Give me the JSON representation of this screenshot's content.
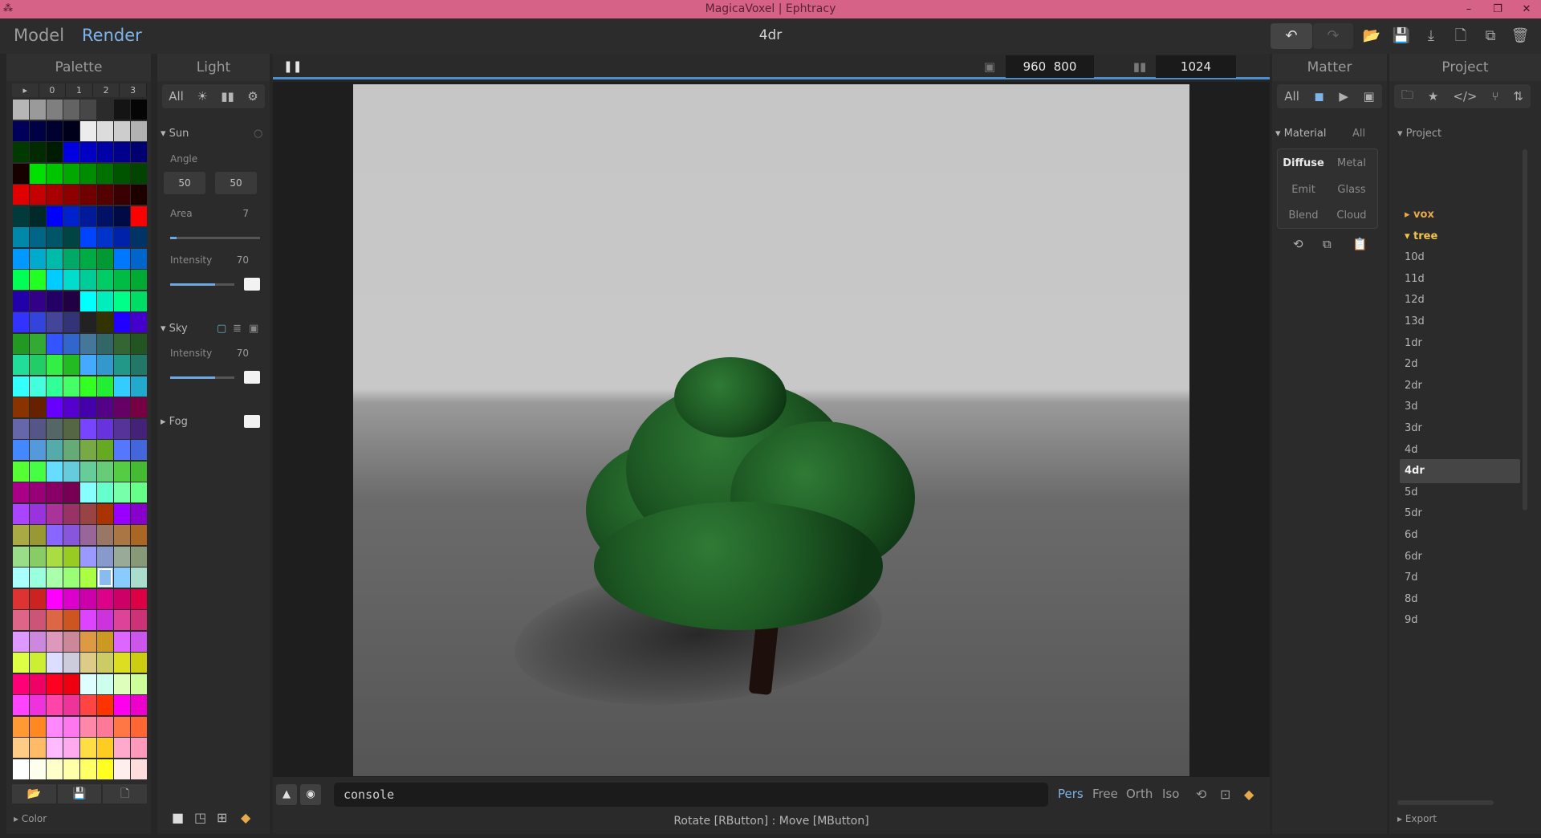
{
  "window": {
    "title": "MagicaVoxel | Ephtracy",
    "minimize": "–",
    "restore": "❐",
    "close": "✕"
  },
  "menu": {
    "model": "Model",
    "render": "Render",
    "doc_title": "4dr"
  },
  "palette": {
    "title": "Palette",
    "tabs": [
      "▸",
      "0",
      "1",
      "2",
      "3"
    ],
    "footer_label": "Color",
    "colors": [
      [
        "#b6b6b6",
        "#9a9a9a",
        "#7f7f7f",
        "#636363",
        "#474747",
        "#2b2b2b",
        "#141414",
        "#050505"
      ],
      [
        "#00005a",
        "#000044",
        "#00002e",
        "#00001a",
        "#ececec",
        "#dcdcdc",
        "#cdcdcd",
        "#b2b2b2"
      ],
      [
        "#003a00",
        "#002a00",
        "#001c00",
        "#0000e0",
        "#0000c4",
        "#0000a8",
        "#00008c",
        "#000070"
      ],
      [
        "#160000",
        "#00e000",
        "#00c400",
        "#00a800",
        "#008c00",
        "#007000",
        "#005400",
        "#004400"
      ],
      [
        "#e00000",
        "#c40000",
        "#a80000",
        "#8c0000",
        "#700000",
        "#540000",
        "#380000",
        "#1c0000"
      ],
      [
        "#003a3a",
        "#002a2a",
        "#0000ff",
        "#0022cc",
        "#001a99",
        "#001166",
        "#000a44",
        "#ff0000"
      ],
      [
        "#0088aa",
        "#006688",
        "#005566",
        "#004444",
        "#0044ff",
        "#0033cc",
        "#0022aa",
        "#003366"
      ],
      [
        "#0099ff",
        "#00aacc",
        "#00bbaa",
        "#00aa66",
        "#00aa44",
        "#009933",
        "#0077ff",
        "#0066cc"
      ],
      [
        "#00ff55",
        "#22ff22",
        "#00ccff",
        "#00ddcc",
        "#00cc99",
        "#00cc66",
        "#00bb44",
        "#00aa33"
      ],
      [
        "#2200aa",
        "#330088",
        "#220066",
        "#220044",
        "#00ffff",
        "#00eebb",
        "#00ff88",
        "#00dd66"
      ],
      [
        "#3333ff",
        "#3344dd",
        "#444499",
        "#333377",
        "#222222",
        "#333300",
        "#2200ff",
        "#4400cc"
      ],
      [
        "#229922",
        "#33aa33",
        "#3355ff",
        "#3366cc",
        "#447799",
        "#336666",
        "#336633",
        "#225522"
      ],
      [
        "#22dd99",
        "#22cc66",
        "#33ee44",
        "#22bb22",
        "#44aaff",
        "#3399cc",
        "#229988",
        "#227766"
      ],
      [
        "#33ffff",
        "#44ffdd",
        "#33ff99",
        "#44ff66",
        "#33ff22",
        "#22ee33",
        "#33ccff",
        "#22aacc"
      ],
      [
        "#883300",
        "#662200",
        "#6600ff",
        "#5500cc",
        "#4400aa",
        "#550088",
        "#660066",
        "#770044"
      ],
      [
        "#6666aa",
        "#555588",
        "#556666",
        "#556644",
        "#7744ff",
        "#6633dd",
        "#553399",
        "#442277"
      ],
      [
        "#4488ff",
        "#5599dd",
        "#55aaaa",
        "#66aa77",
        "#77aa44",
        "#66aa22",
        "#5577ff",
        "#4466dd"
      ],
      [
        "#55ff33",
        "#44ff44",
        "#66ddff",
        "#66ccdd",
        "#66cc99",
        "#66cc77",
        "#55cc44",
        "#44bb33"
      ],
      [
        "#aa0088",
        "#990077",
        "#880066",
        "#770055",
        "#88ffff",
        "#66ffcc",
        "#77ffaa",
        "#66ff88"
      ],
      [
        "#aa44ff",
        "#9933dd",
        "#aa3399",
        "#993366",
        "#994444",
        "#aa3300",
        "#9900ff",
        "#8800cc"
      ],
      [
        "#aaaa44",
        "#999933",
        "#8866ff",
        "#8855dd",
        "#996699",
        "#997766",
        "#aa7744",
        "#aa6622"
      ],
      [
        "#99dd88",
        "#88cc66",
        "#aadd44",
        "#99cc22",
        "#9999ff",
        "#8899cc",
        "#99aa99",
        "#889977"
      ],
      [
        "#aaffff",
        "#99ffdd",
        "#aaffaa",
        "#99ff77",
        "#aaff44",
        "#99ff22",
        "#88ccff",
        "#aaddcc"
      ],
      [
        "#dd3333",
        "#cc2222",
        "#ff00ff",
        "#dd00cc",
        "#cc00aa",
        "#dd0088",
        "#cc0066",
        "#dd0044"
      ],
      [
        "#dd6688",
        "#cc5577",
        "#dd6644",
        "#cc5522",
        "#dd44ff",
        "#cc33dd",
        "#dd4499",
        "#cc3377"
      ],
      [
        "#dd99ff",
        "#cc88dd",
        "#dd99bb",
        "#cc8899",
        "#dd9944",
        "#cc9922",
        "#dd66ff",
        "#cc55ee"
      ],
      [
        "#ddff44",
        "#ccee33",
        "#ddddff",
        "#ccccdd",
        "#ddcc88",
        "#cccc66",
        "#dddd22",
        "#cccc11"
      ],
      [
        "#ff0077",
        "#ee0066",
        "#ff0022",
        "#ee0011",
        "#ddffff",
        "#ccffee",
        "#ddffbb",
        "#ccff99"
      ],
      [
        "#ff44ff",
        "#ee33dd",
        "#ff44aa",
        "#ee3399",
        "#ff4444",
        "#ff3300",
        "#ff00ee",
        "#ee00cc"
      ],
      [
        "#ff9933",
        "#ff8822",
        "#ff88ff",
        "#ff77ee",
        "#ff88aa",
        "#ff7799",
        "#ff7744",
        "#ff6633"
      ],
      [
        "#ffcc88",
        "#ffbb66",
        "#ffbbff",
        "#ffaaee",
        "#ffdd44",
        "#ffcc22",
        "#ffaacc",
        "#ff99bb"
      ],
      [
        "#ffffff",
        "#ffffee",
        "#ffffcc",
        "#ffffaa",
        "#ffff66",
        "#ffff22",
        "#ffeeee",
        "#ffdddd"
      ]
    ]
  },
  "light": {
    "title": "Light",
    "filter_all": "All",
    "sun": {
      "label": "Sun",
      "angle_label": "Angle",
      "angle_a": "50",
      "angle_b": "50",
      "area_label": "Area",
      "area_value": "7",
      "area_fill": 0.07,
      "intensity_label": "Intensity",
      "intensity_value": "70",
      "intensity_fill": 0.7
    },
    "sky": {
      "label": "Sky",
      "intensity_label": "Intensity",
      "intensity_value": "70",
      "intensity_fill": 0.7
    },
    "fog": {
      "label": "Fog"
    }
  },
  "viewport": {
    "width": "960",
    "height": "800",
    "samples": "1024",
    "console": "console",
    "status": "Rotate [RButton] : Move [MButton]",
    "modes": [
      "Pers",
      "Free",
      "Orth",
      "Iso"
    ]
  },
  "matter": {
    "title": "Matter",
    "tab_all": "All",
    "material_label": "Material",
    "material_all": "All",
    "materials": [
      "Diffuse",
      "Metal",
      "Emit",
      "Glass",
      "Blend",
      "Cloud"
    ]
  },
  "project": {
    "title": "Project",
    "section": "Project",
    "items": [
      "vox",
      "tree",
      "10d",
      "11d",
      "12d",
      "13d",
      "1dr",
      "2d",
      "2dr",
      "3d",
      "3dr",
      "4d",
      "4dr",
      "5d",
      "5dr",
      "6d",
      "6dr",
      "7d",
      "8d",
      "9d"
    ],
    "export_label": "Export"
  },
  "colors": {
    "accent": "#7fb4e8",
    "titlebar": "#d66288",
    "folder": "#e6a94b"
  }
}
